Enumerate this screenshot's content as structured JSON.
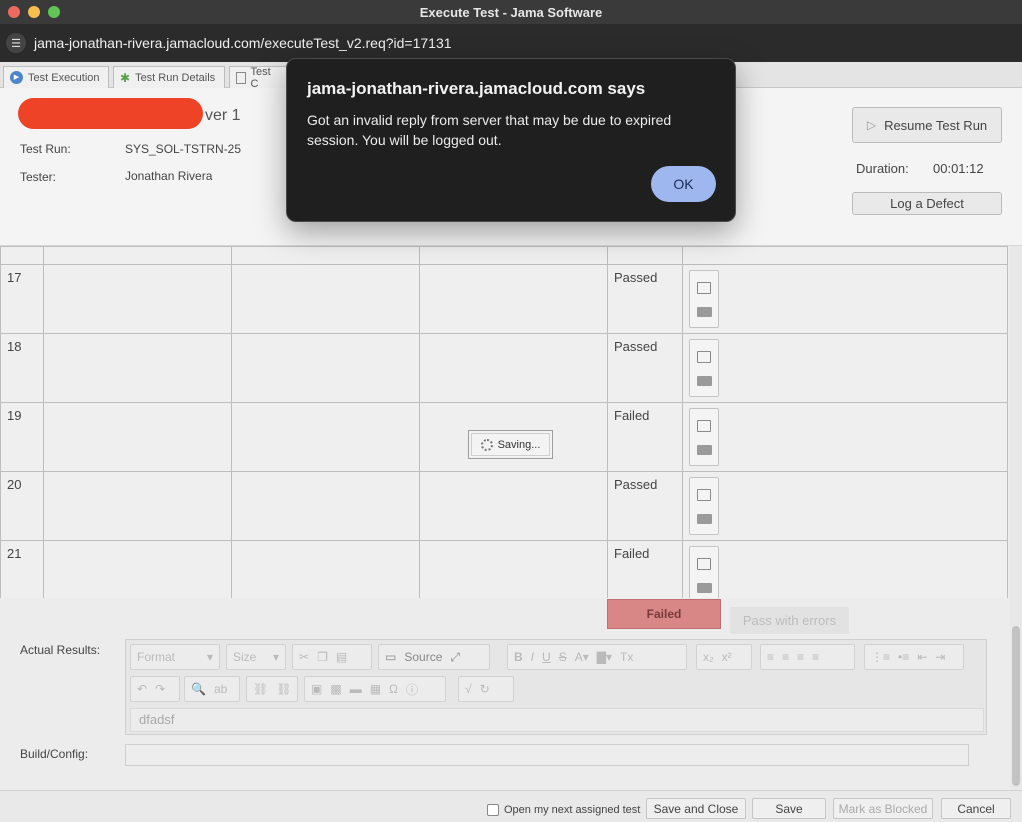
{
  "window": {
    "title": "Execute Test - Jama Software",
    "url": "jama-jonathan-rivera.jamacloud.com/executeTest_v2.req?id=17131"
  },
  "tabs": [
    {
      "label": "Test Execution"
    },
    {
      "label": "Test Run Details"
    },
    {
      "label": "Test C"
    }
  ],
  "header": {
    "version": "ver 1",
    "test_run_label": "Test Run:",
    "test_run_value": "SYS_SOL-TSTRN-25",
    "tester_label": "Tester:",
    "tester_value": "Jonathan Rivera",
    "resume_button": "Resume Test Run",
    "duration_label": "Duration:",
    "duration_value": "00:01:12",
    "log_defect_button": "Log a Defect"
  },
  "steps": [
    {
      "num": "17",
      "status": "Passed"
    },
    {
      "num": "18",
      "status": "Passed"
    },
    {
      "num": "19",
      "status": "Failed"
    },
    {
      "num": "20",
      "status": "Passed"
    },
    {
      "num": "21",
      "status": "Failed"
    }
  ],
  "saving_label": "Saving...",
  "result_buttons": {
    "failed": "Failed",
    "pass_with_errors": "Pass with errors"
  },
  "actual_results": {
    "label": "Actual Results:",
    "format_placeholder": "Format",
    "size_placeholder": "Size",
    "source_label": "Source",
    "content": "dfadsf"
  },
  "build_config": {
    "label": "Build/Config:",
    "value": ""
  },
  "footer": {
    "checkbox_label": "Open my next assigned test",
    "save_close": "Save and Close",
    "save": "Save",
    "mark_blocked": "Mark as Blocked",
    "cancel": "Cancel"
  },
  "dialog": {
    "title": "jama-jonathan-rivera.jamacloud.com says",
    "message": "Got an invalid reply from server that may be due to expired session. You will be logged out.",
    "ok_label": "OK"
  },
  "colors": {
    "redacted": "#ef4328",
    "failed_bg": "#d88686",
    "ok_button": "#9fb7ef",
    "dialog_bg": "#1f1f1f"
  }
}
